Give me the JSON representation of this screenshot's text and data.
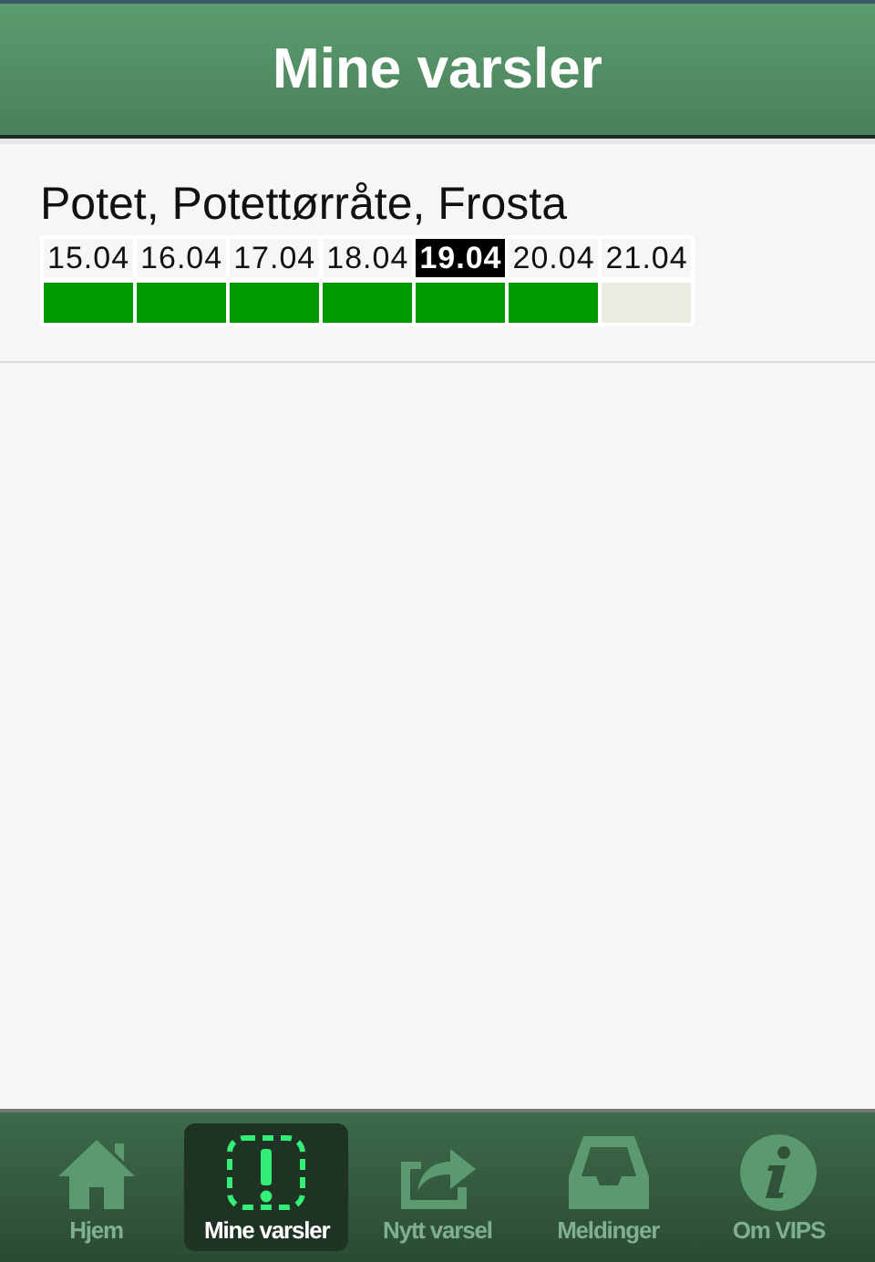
{
  "header": {
    "title": "Mine varsler"
  },
  "forecasts": [
    {
      "title": "Potet, Potettørråte, Frosta",
      "days": [
        {
          "date": "15.04",
          "selected": false,
          "color": "#009900"
        },
        {
          "date": "16.04",
          "selected": false,
          "color": "#009900"
        },
        {
          "date": "17.04",
          "selected": false,
          "color": "#009900"
        },
        {
          "date": "18.04",
          "selected": false,
          "color": "#009900"
        },
        {
          "date": "19.04",
          "selected": true,
          "color": "#009900"
        },
        {
          "date": "20.04",
          "selected": false,
          "color": "#009900"
        },
        {
          "date": "21.04",
          "selected": false,
          "color": "#ebebdf"
        }
      ]
    }
  ],
  "tabbar": [
    {
      "kind": "home",
      "label": "Hjem",
      "selected": false
    },
    {
      "kind": "alert",
      "label": "Mine varsler",
      "selected": true
    },
    {
      "kind": "share",
      "label": "Nytt varsel",
      "selected": false
    },
    {
      "kind": "inbox",
      "label": "Meldinger",
      "selected": false
    },
    {
      "kind": "info",
      "label": "Om VIPS",
      "selected": false
    }
  ]
}
